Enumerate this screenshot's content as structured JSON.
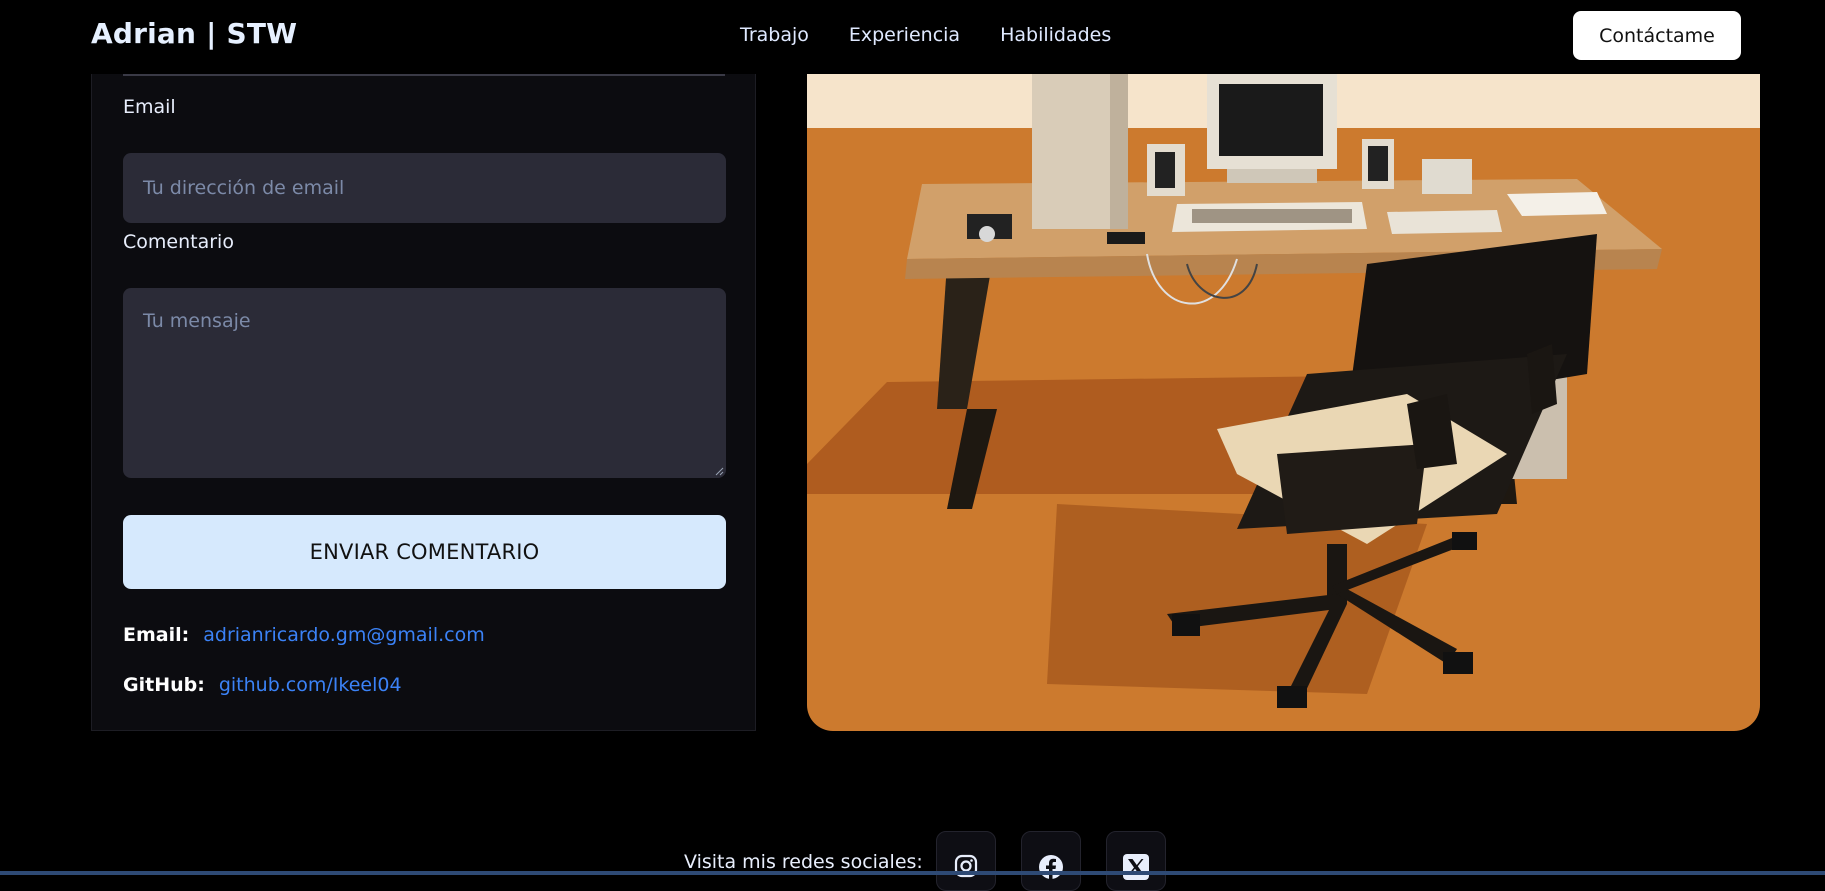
{
  "nav": {
    "brand": "Adrian | STW",
    "items": [
      "Trabajo",
      "Experiencia",
      "Habilidades"
    ],
    "contact_button": "Contáctame"
  },
  "form": {
    "email_label": "Email",
    "email_placeholder": "Tu dirección de email",
    "comment_label": "Comentario",
    "comment_placeholder": "Tu mensaje",
    "submit_label": "ENVIAR COMENTARIO"
  },
  "contact_info": {
    "email_label": "Email:",
    "email_value": "adrianricardo.gm@gmail.com",
    "github_label": "GitHub:",
    "github_value": "github.com/Ikeel04"
  },
  "footer": {
    "social_label": "Visita mis redes sociales:",
    "icons": [
      "instagram-icon",
      "facebook-icon",
      "x-icon"
    ]
  },
  "colors": {
    "background": "#000000",
    "card": "#0c0c10",
    "input": "#2b2b37",
    "button": "#d6e9fd",
    "link": "#3b82f6",
    "scene_floor": "#cc7a2e"
  }
}
